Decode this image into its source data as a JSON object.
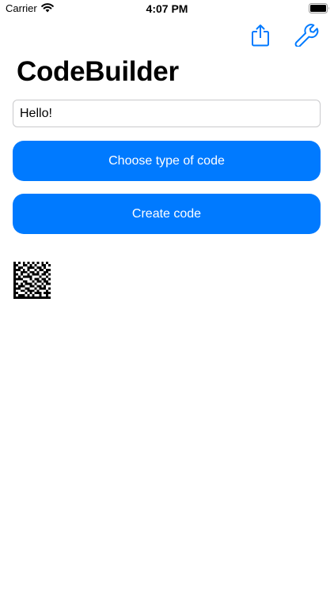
{
  "status_bar": {
    "carrier": "Carrier",
    "time": "4:07 PM",
    "wifi_icon": "wifi-icon",
    "battery_icon": "battery-icon",
    "battery_level": 1.0
  },
  "nav": {
    "share_icon": "share-icon",
    "settings_icon": "wrench-icon"
  },
  "title": "CodeBuilder",
  "input": {
    "value": "Hello!",
    "placeholder": ""
  },
  "buttons": {
    "choose_type": "Choose type of code",
    "create_code": "Create code"
  },
  "code_image": {
    "icon": "datamatrix-code-image"
  },
  "colors": {
    "accent": "#007aff",
    "background": "#ffffff",
    "text": "#000000",
    "button_text": "#ffffff",
    "input_border": "#c9c9cc"
  }
}
